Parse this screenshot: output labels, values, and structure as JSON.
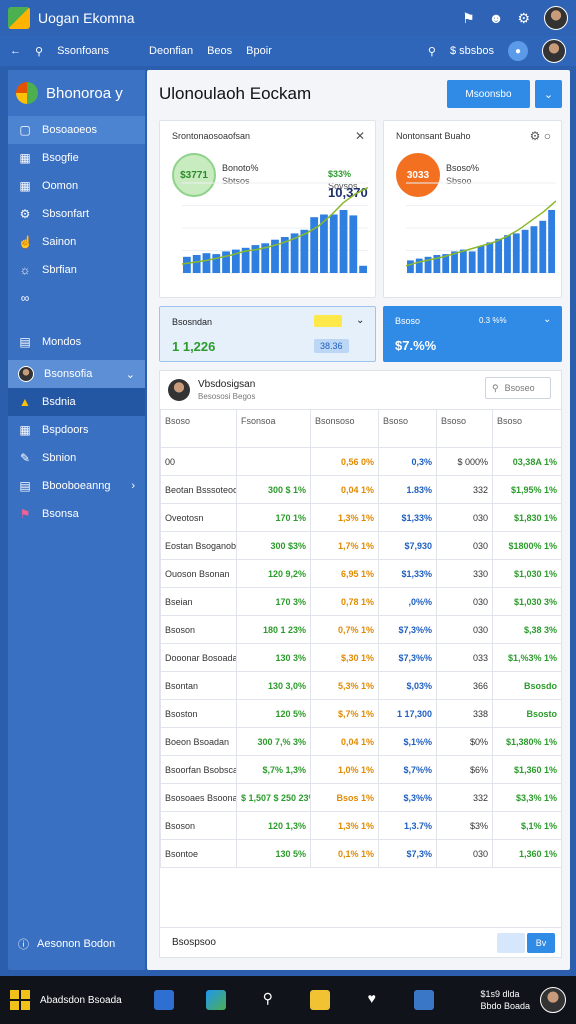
{
  "window": {
    "title": "Uogan Ekomna"
  },
  "navbar": {
    "search_label": "Ssonfoans",
    "links": [
      "Deonfian",
      "Beos",
      "Bpoir"
    ],
    "right_label": "$ sbsbos"
  },
  "sidebar": {
    "brand": "Bhonoroa y",
    "items": [
      {
        "label": "Bosoaoeos",
        "icon": "square-icon"
      },
      {
        "label": "Bsogfie",
        "icon": "calendar-icon"
      },
      {
        "label": "Oomon",
        "icon": "grid-icon"
      },
      {
        "label": "Sbsonfart",
        "icon": "gear-icon"
      },
      {
        "label": "Sainon",
        "icon": "thumb-icon"
      },
      {
        "label": "Sbrfian",
        "icon": "settings-icon"
      },
      {
        "label": "",
        "icon": "link-icon"
      },
      {
        "label": "Mondos",
        "icon": "menu-icon"
      },
      {
        "label": "Bsonsofia",
        "icon": "avatar"
      },
      {
        "label": "Bsdnia",
        "icon": "chart-icon"
      },
      {
        "label": "Bspdoors",
        "icon": "document-icon"
      },
      {
        "label": "Sbnion",
        "icon": "edit-icon"
      },
      {
        "label": "Bbooboeanng",
        "icon": "bar-icon"
      },
      {
        "label": "Bsonsa",
        "icon": "flag-icon"
      }
    ],
    "footer": "Aesonon Bodon"
  },
  "main": {
    "title": "Ulonoulaoh Eockam",
    "primary_button": "Msoonsbo",
    "card1": {
      "title": "Srontonaosoaofsan",
      "badge": "$3771",
      "label1": "Bonoto%",
      "label2": "Sbtsos",
      "value_a": "$33%",
      "value_b": "Sovsos",
      "big": "10,370"
    },
    "card2": {
      "title": "Nontonsant Buaho",
      "badge": "3033",
      "label1": "Bsoso%",
      "label2": "Sbsoo"
    },
    "summary1": {
      "label": "Bsosndan",
      "value": "1 1,226",
      "tag": "38.36"
    },
    "summary2": {
      "label": "Bsoso",
      "value": "$7.%%",
      "mid": "0.3 %%"
    },
    "table_head": {
      "name": "Vbsdosigsan",
      "sub": "Besososi Begos",
      "search": "Bsoseo"
    }
  },
  "table": {
    "headers": [
      "Bsoso",
      "Fsonsoa",
      "Bsonsoso",
      "Bsoso",
      "Bsoso",
      "Bsoso"
    ],
    "first_row": [
      "00",
      "",
      "0,56  0%",
      "0,3%",
      "$ 000%",
      "03,38A  1%"
    ],
    "rows": [
      [
        "Beotan  Bsssoteoon",
        "300  $ 1%",
        "0,04  1%",
        "1.83%",
        "332",
        "$1,95%  1%"
      ],
      [
        "Oveotosn",
        "170  1%",
        "1,3%  1%",
        "$1,33%",
        "030",
        "$1,830  1%"
      ],
      [
        "Eostan  Bsoganobaon",
        "300  $3%",
        "1,7%  1%",
        "$7,930",
        "030",
        "$1800%  1%"
      ],
      [
        "Ouoson  Bsonan",
        "120  9,2%",
        "6,95  1%",
        "$1,33%",
        "330",
        "$1,030  1%"
      ],
      [
        "Bseian",
        "170  3%",
        "0,78  1%",
        ",0%%",
        "030",
        "$1,030  3%"
      ],
      [
        "Bsoson",
        "180  1 23%",
        "0,7%  1%",
        "$7,3%%",
        "030",
        "$,38  3%"
      ],
      [
        "Dooonar  Bosoadan",
        "130  3%",
        "$,30  1%",
        "$7,3%%",
        "033",
        "$1,%3%  1%"
      ],
      [
        "Bsontan",
        "130  3,0%",
        "5,3%  1%",
        "$,03%",
        "366",
        "Bsosdo"
      ],
      [
        "Bsoston",
        "120  5%",
        "$,7%  1%",
        "1 17,300",
        "338",
        "Bsosto"
      ],
      [
        "Boeon  Bsoadan",
        "300  7,%  3%",
        "0,04  1%",
        "$,1%%",
        "$0%",
        "$1,380%  1%"
      ],
      [
        "Bsoorfan  Bsobscasan",
        "$,7%  1,3%",
        "1,0%  1%",
        "$,7%%",
        "$6%",
        "$1,360  1%"
      ],
      [
        "Bsosoaes  Bsoonadan",
        "$ 1,507  $ 250  23%",
        "Bsos  1%",
        "$,3%%",
        "332",
        "$3,3%  1%"
      ],
      [
        "Bsoson",
        "120  1,3%",
        "1,3%  1%",
        "1,3.7%",
        "$3%",
        "$,1%  1%"
      ],
      [
        "Bsontoe",
        "130  5%",
        "0,1%  1%",
        "$7,3%",
        "030",
        "1,360  1%"
      ]
    ],
    "footer": "Bsospsoo",
    "next": "Bv"
  },
  "taskbar": {
    "label": "Abadsdon Bsoada",
    "time": "$1s9 dlda",
    "date": "Bbdo Boada"
  },
  "colors": {
    "primary": "#2f8be6",
    "sidebar": "#3a70c1",
    "green": "#2c9b2c",
    "orange": "#e08a00"
  },
  "chart_data": [
    {
      "type": "bar",
      "values": [
        18,
        20,
        22,
        21,
        24,
        26,
        28,
        31,
        33,
        37,
        40,
        44,
        48,
        62,
        65,
        65,
        70,
        64,
        8
      ],
      "line": [
        10,
        12,
        14,
        17,
        20,
        24,
        26,
        29,
        33,
        38,
        44,
        52,
        64,
        78,
        88,
        95
      ]
    },
    {
      "type": "bar",
      "values": [
        14,
        16,
        18,
        20,
        21,
        24,
        26,
        24,
        30,
        34,
        38,
        42,
        44,
        48,
        52,
        58,
        70
      ],
      "line": [
        8,
        12,
        15,
        18,
        22,
        26,
        30,
        34,
        40,
        48,
        58,
        68,
        80
      ]
    }
  ]
}
